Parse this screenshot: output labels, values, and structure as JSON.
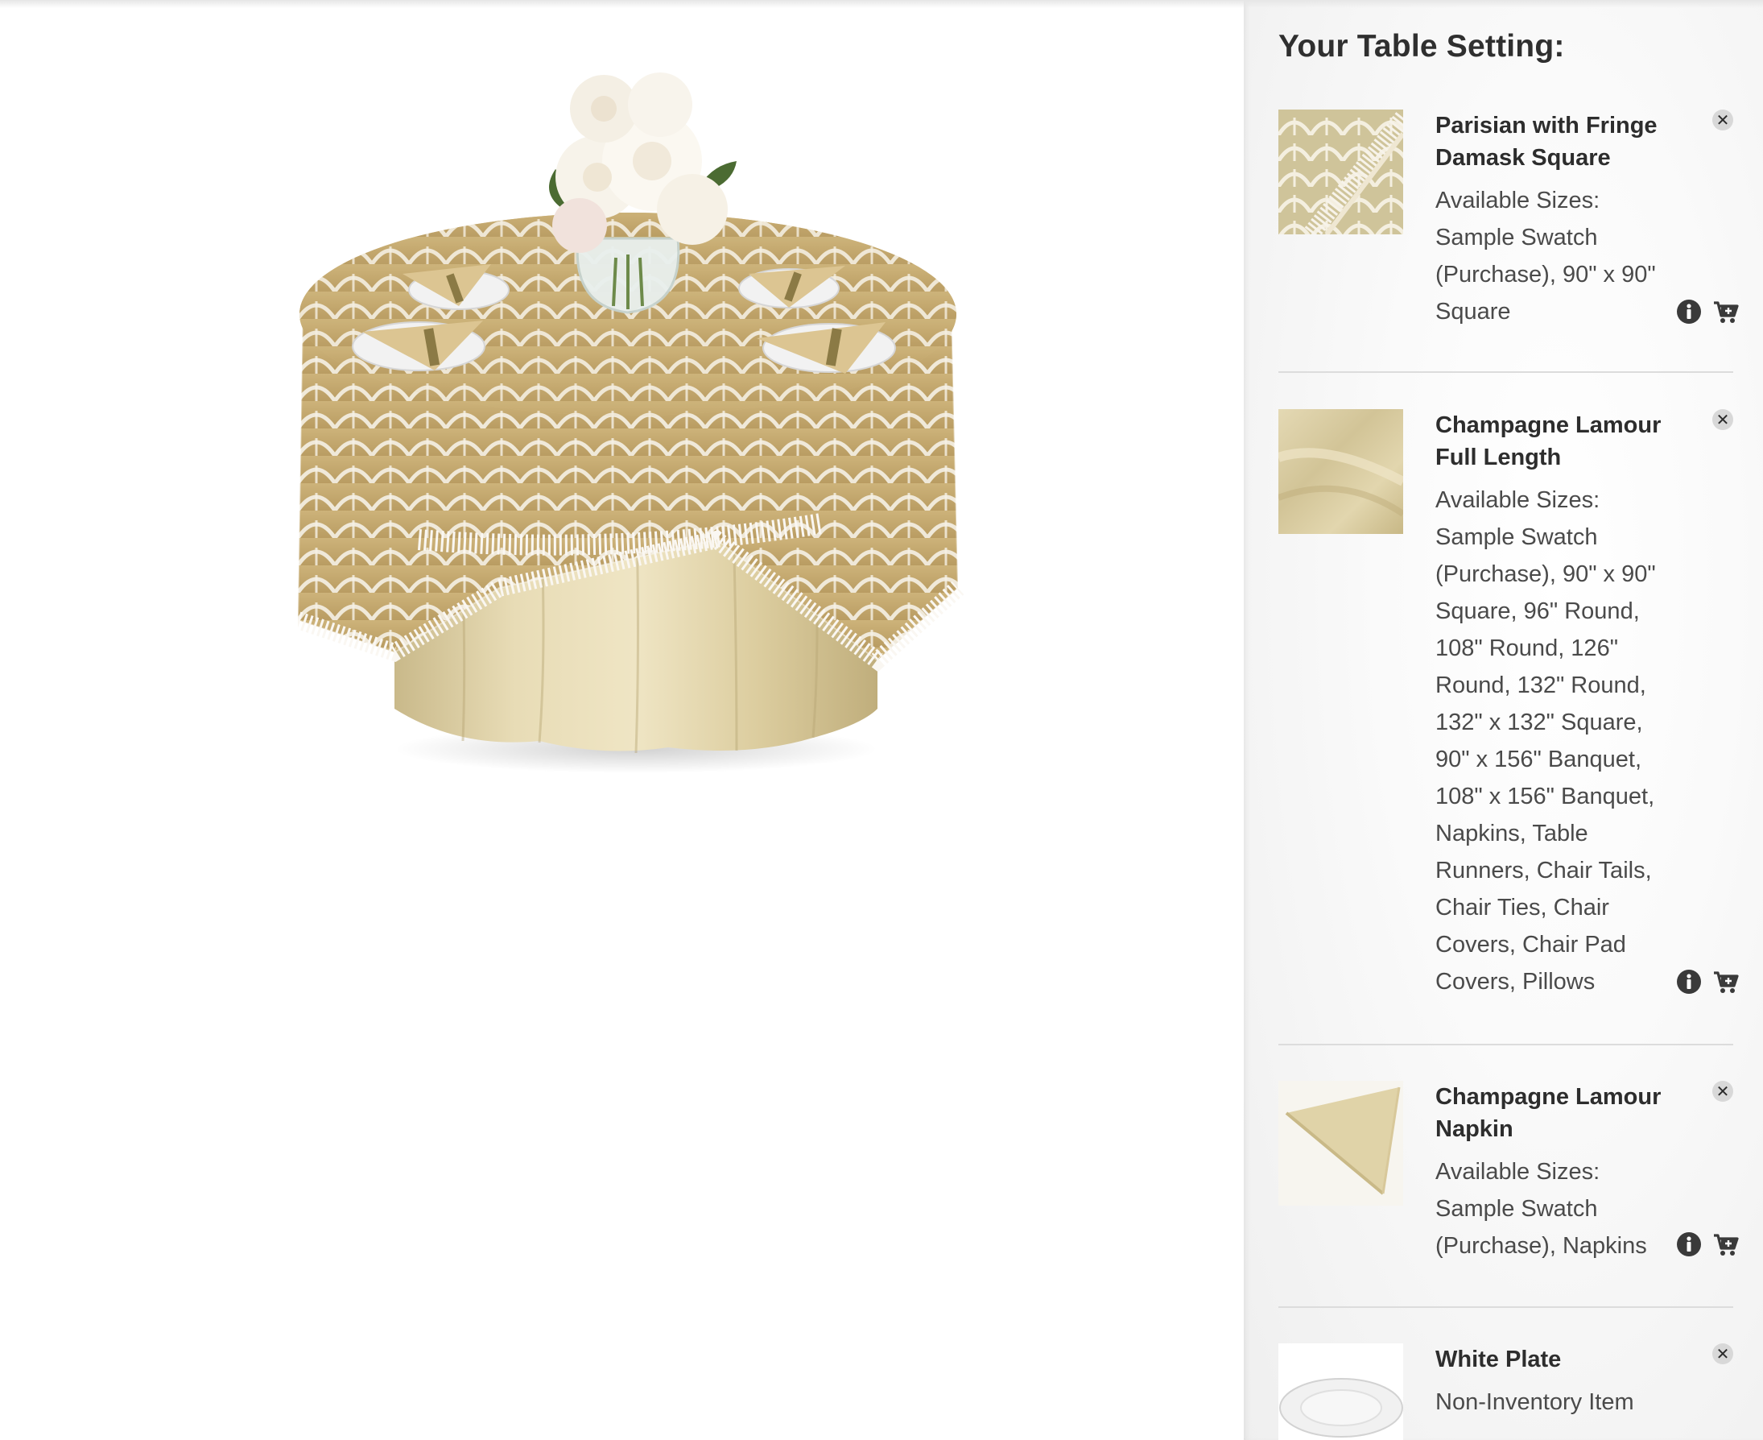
{
  "sidebar": {
    "title": "Your Table Setting:",
    "items": [
      {
        "name_line1": "Parisian with Fringe",
        "name_line2": "Damask Square",
        "sizes_label": "Available Sizes:",
        "sizes_lines": [
          "Sample Swatch",
          "(Purchase), 90\" x 90\"",
          "Square"
        ],
        "thumb": "damask-lace-swatch"
      },
      {
        "name_line1": "Champagne Lamour",
        "name_line2": "Full Length",
        "sizes_label": "Available Sizes:",
        "sizes_lines": [
          "Sample Swatch",
          "(Purchase), 90\" x 90\"",
          "Square, 96\" Round,",
          "108\" Round, 126\"",
          "Round, 132\" Round,",
          "132\" x 132\" Square,",
          "90\" x 156\" Banquet,",
          "108\" x 156\" Banquet,",
          "Napkins, Table",
          "Runners, Chair Tails,",
          "Chair Ties, Chair",
          "Covers, Chair Pad",
          "Covers, Pillows"
        ],
        "thumb": "champagne-fabric-swatch"
      },
      {
        "name_line1": "Champagne Lamour",
        "name_line2": "Napkin",
        "sizes_label": "Available Sizes:",
        "sizes_lines": [
          "Sample Swatch",
          "(Purchase), Napkins"
        ],
        "thumb": "folded-napkin"
      },
      {
        "name_line1": "White Plate",
        "name_line2": "",
        "sizes_label": "Non-Inventory Item",
        "sizes_lines": [],
        "thumb": "white-plate"
      }
    ],
    "icons": {
      "remove": "close-circle-icon",
      "info": "info-icon",
      "cart": "add-to-cart-icon"
    }
  },
  "colors": {
    "sidebar_bg": "#f4f4f4",
    "champagne": "#d8c99a",
    "lace": "#ffffff",
    "text_dark": "#2d2d2d",
    "text_body": "#4a4a4a"
  }
}
